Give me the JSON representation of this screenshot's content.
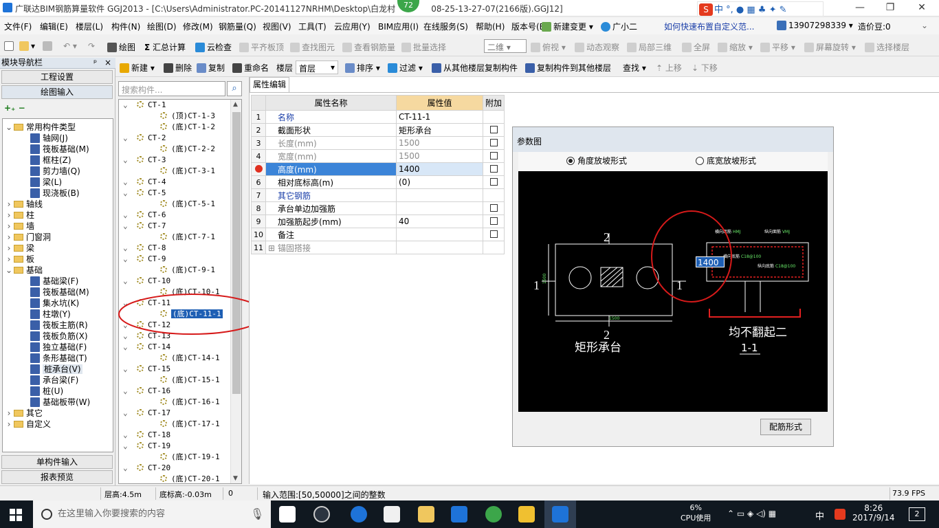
{
  "window": {
    "title": "广联达BIM钢筋算量软件 GGJ2013 - [C:\\Users\\Administrator.PC-20141127NRHM\\Desktop\\白龙村",
    "title_suffix": "08-25-13-27-07(2166版).GGJ12]",
    "badge": "72"
  },
  "menu": [
    "文件(F)",
    "编辑(E)",
    "楼层(L)",
    "构件(N)",
    "绘图(D)",
    "修改(M)",
    "钢筋量(Q)",
    "视图(V)",
    "工具(T)",
    "云应用(Y)",
    "BIM应用(I)",
    "在线服务(S)",
    "帮助(H)",
    "版本号(B)"
  ],
  "menu_right": {
    "new_change": "新建变更",
    "xiaoer": "广小二",
    "question": "如何快速布置自定义范...",
    "phone": "13907298339",
    "points": "造价豆:0"
  },
  "toolbar1": {
    "draw": "绘图",
    "sum": "汇总计算",
    "cloud_check": "云检查",
    "level_board": "平齐板顶",
    "find_elem": "查找图元",
    "view_rebar": "查看钢筋量",
    "batch_select": "批量选择",
    "view_mode": "二维",
    "top_view": "俯视",
    "dynamic": "动态观察",
    "local3d": "局部三维",
    "fullscreen": "全屏",
    "zoom": "缩放",
    "pan": "平移",
    "rotate": "屏幕旋转",
    "select_floor": "选择楼层"
  },
  "toolbar2": {
    "new": "新建",
    "delete": "删除",
    "copy": "复制",
    "rename": "重命名",
    "floor_label": "楼层",
    "floor_value": "首层",
    "sort": "排序",
    "filter": "过滤",
    "copy_from": "从其他楼层复制构件",
    "copy_to": "复制构件到其他楼层",
    "find": "查找",
    "up": "上移",
    "down": "下移"
  },
  "nav": {
    "header": "模块导航栏",
    "project_settings": "工程设置",
    "draw_input": "绘图输入",
    "single_input": "单构件输入",
    "report": "报表预览",
    "tree": [
      {
        "label": "常用构件类型",
        "level": 0,
        "type": "folder",
        "open": true
      },
      {
        "label": "轴网(J)",
        "level": 1,
        "type": "comp"
      },
      {
        "label": "筏板基础(M)",
        "level": 1,
        "type": "comp"
      },
      {
        "label": "框柱(Z)",
        "level": 1,
        "type": "comp"
      },
      {
        "label": "剪力墙(Q)",
        "level": 1,
        "type": "comp"
      },
      {
        "label": "梁(L)",
        "level": 1,
        "type": "comp"
      },
      {
        "label": "现浇板(B)",
        "level": 1,
        "type": "comp"
      },
      {
        "label": "轴线",
        "level": 0,
        "type": "folder"
      },
      {
        "label": "柱",
        "level": 0,
        "type": "folder"
      },
      {
        "label": "墙",
        "level": 0,
        "type": "folder"
      },
      {
        "label": "门窗洞",
        "level": 0,
        "type": "folder"
      },
      {
        "label": "梁",
        "level": 0,
        "type": "folder"
      },
      {
        "label": "板",
        "level": 0,
        "type": "folder"
      },
      {
        "label": "基础",
        "level": 0,
        "type": "folder",
        "open": true
      },
      {
        "label": "基础梁(F)",
        "level": 1,
        "type": "comp"
      },
      {
        "label": "筏板基础(M)",
        "level": 1,
        "type": "comp"
      },
      {
        "label": "集水坑(K)",
        "level": 1,
        "type": "comp"
      },
      {
        "label": "柱墩(Y)",
        "level": 1,
        "type": "comp"
      },
      {
        "label": "筏板主筋(R)",
        "level": 1,
        "type": "comp"
      },
      {
        "label": "筏板负筋(X)",
        "level": 1,
        "type": "comp"
      },
      {
        "label": "独立基础(F)",
        "level": 1,
        "type": "comp"
      },
      {
        "label": "条形基础(T)",
        "level": 1,
        "type": "comp"
      },
      {
        "label": "桩承台(V)",
        "level": 1,
        "type": "comp",
        "selected": true
      },
      {
        "label": "承台梁(F)",
        "level": 1,
        "type": "comp"
      },
      {
        "label": "桩(U)",
        "level": 1,
        "type": "comp"
      },
      {
        "label": "基础板带(W)",
        "level": 1,
        "type": "comp"
      },
      {
        "label": "其它",
        "level": 0,
        "type": "folder"
      },
      {
        "label": "自定义",
        "level": 0,
        "type": "folder"
      }
    ]
  },
  "complist": {
    "search_placeholder": "搜索构件...",
    "items": [
      {
        "label": "CT-1",
        "level": 0
      },
      {
        "label": "(顶)CT-1-3",
        "level": 1
      },
      {
        "label": "(底)CT-1-2",
        "level": 1
      },
      {
        "label": "CT-2",
        "level": 0
      },
      {
        "label": "(底)CT-2-2",
        "level": 1
      },
      {
        "label": "CT-3",
        "level": 0
      },
      {
        "label": "(底)CT-3-1",
        "level": 1
      },
      {
        "label": "CT-4",
        "level": 0
      },
      {
        "label": "CT-5",
        "level": 0
      },
      {
        "label": "(底)CT-5-1",
        "level": 1
      },
      {
        "label": "CT-6",
        "level": 0
      },
      {
        "label": "CT-7",
        "level": 0
      },
      {
        "label": "(底)CT-7-1",
        "level": 1
      },
      {
        "label": "CT-8",
        "level": 0
      },
      {
        "label": "CT-9",
        "level": 0
      },
      {
        "label": "(底)CT-9-1",
        "level": 1
      },
      {
        "label": "CT-10",
        "level": 0
      },
      {
        "label": "(底)CT-10-1",
        "level": 1
      },
      {
        "label": "CT-11",
        "level": 0
      },
      {
        "label": "(底)CT-11-1",
        "level": 1,
        "selected": true
      },
      {
        "label": "CT-12",
        "level": 0
      },
      {
        "label": "CT-13",
        "level": 0
      },
      {
        "label": "CT-14",
        "level": 0
      },
      {
        "label": "(底)CT-14-1",
        "level": 1
      },
      {
        "label": "CT-15",
        "level": 0
      },
      {
        "label": "(底)CT-15-1",
        "level": 1
      },
      {
        "label": "CT-16",
        "level": 0
      },
      {
        "label": "(底)CT-16-1",
        "level": 1
      },
      {
        "label": "CT-17",
        "level": 0
      },
      {
        "label": "(底)CT-17-1",
        "level": 1
      },
      {
        "label": "CT-18",
        "level": 0
      },
      {
        "label": "CT-19",
        "level": 0
      },
      {
        "label": "(底)CT-19-1",
        "level": 1
      },
      {
        "label": "CT-20",
        "level": 0
      },
      {
        "label": "(底)CT-20-1",
        "level": 1
      }
    ]
  },
  "props": {
    "tab": "属性编辑",
    "headers": [
      "属性名称",
      "属性值",
      "附加"
    ],
    "rows": [
      {
        "num": "1",
        "name": "名称",
        "value": "CT-11-1",
        "style": "blue",
        "check": false
      },
      {
        "num": "2",
        "name": "截面形状",
        "value": "矩形承台",
        "style": "",
        "check": true
      },
      {
        "num": "3",
        "name": "长度(mm)",
        "value": "1500",
        "style": "grey",
        "check": true
      },
      {
        "num": "4",
        "name": "宽度(mm)",
        "value": "1500",
        "style": "grey",
        "check": true
      },
      {
        "num": "",
        "name": "高度(mm)",
        "value": "1400",
        "style": "sel",
        "check": true
      },
      {
        "num": "6",
        "name": "相对底标高(m)",
        "value": "(0)",
        "style": "",
        "check": true
      },
      {
        "num": "7",
        "name": "其它钢筋",
        "value": "",
        "style": "blue",
        "check": false
      },
      {
        "num": "8",
        "name": "承台单边加强筋",
        "value": "",
        "style": "",
        "check": true
      },
      {
        "num": "9",
        "name": "加强筋起步(mm)",
        "value": "40",
        "style": "",
        "check": true
      },
      {
        "num": "10",
        "name": "备注",
        "value": "",
        "style": "",
        "check": true
      },
      {
        "num": "11",
        "name": "锚固搭接",
        "value": "",
        "style": "grey",
        "check": false,
        "expand": "+"
      }
    ]
  },
  "param": {
    "title": "参数图",
    "radio1": "角度放坡形式",
    "radio2": "底宽放坡形式",
    "button": "配筋形式",
    "drawing": {
      "label_2_top": "2",
      "label_2_bottom": "2",
      "label_1_left": "1",
      "label_1_right": "1",
      "dim_side": "1500",
      "dim_bottom": "1500",
      "name": "矩形承台",
      "section_note": "均不翻起二",
      "section_label": "1-1",
      "height_input": "1400",
      "h_top": "横向面筋",
      "v_top": "纵向面筋",
      "h_bottom": "横向底筋",
      "v_bottom": "纵向底筋",
      "rebar1": "C18@100",
      "rebar2": "C18@100",
      "tag_vmj": "VMJ",
      "tag_hmj": "HMJ"
    }
  },
  "status": {
    "floor_height": "层高:4.5m",
    "base_elev": "底标高:-0.03m",
    "zero": "0",
    "hint": "输入范围:[50,50000]之间的整数",
    "fps": "73.9 FPS"
  },
  "taskbar": {
    "search": "在这里输入你要搜索的内容",
    "cpu_pct": "6%",
    "cpu_label": "CPU使用",
    "ime": "中",
    "time": "8:26",
    "date": "2017/9/14",
    "notif": "2"
  },
  "colors": {
    "accent": "#3b84d8",
    "highlight_header": "#f6d9a0",
    "annotation_red": "#d61a1a",
    "taskbar": "#101820"
  }
}
